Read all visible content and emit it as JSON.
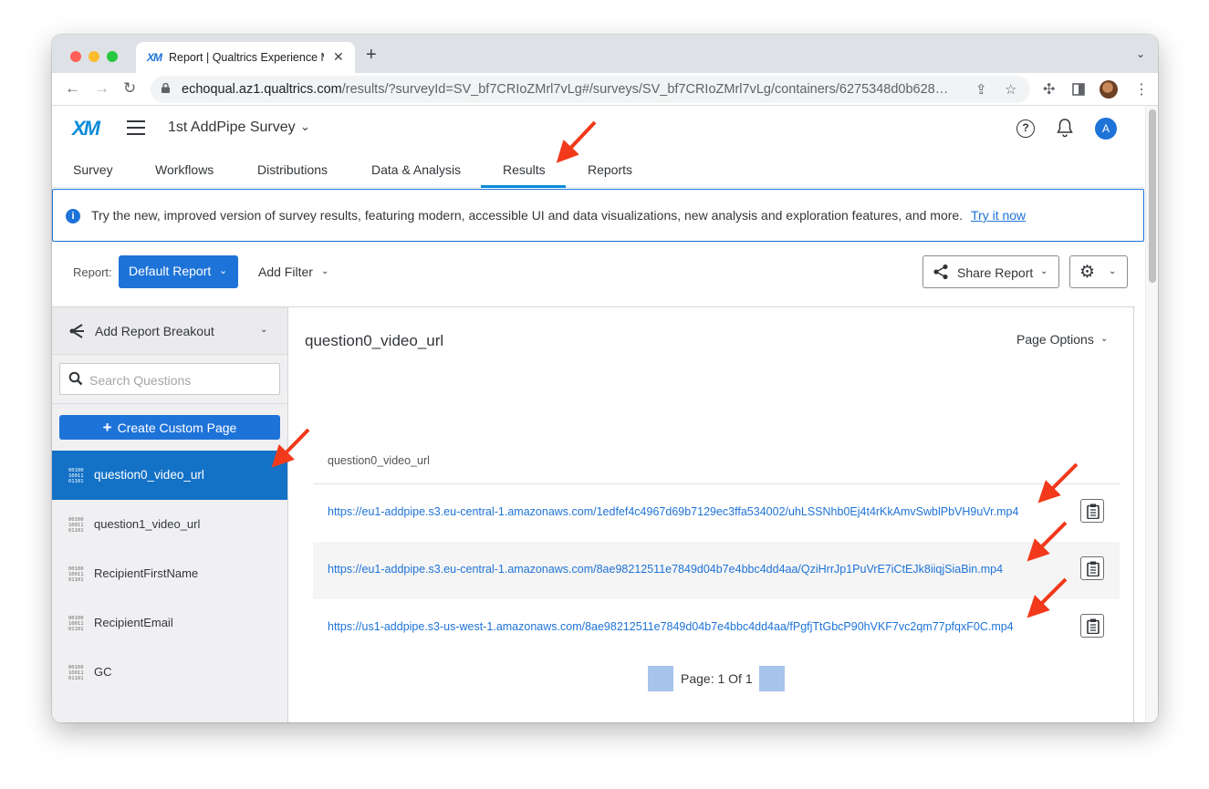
{
  "browser": {
    "tab_title": "Report | Qualtrics Experience Management",
    "tab_favicon": "XM",
    "url_host": "echoqual.az1.qualtrics.com",
    "url_path": "/results/?surveyId=SV_bf7CRIoZMrl7vLg#/surveys/SV_bf7CRIoZMrl7vLg/containers/6275348d0b628…"
  },
  "app": {
    "logo": "XM",
    "survey_name": "1st AddPipe Survey",
    "avatar_initial": "A",
    "nav_tabs": [
      "Survey",
      "Workflows",
      "Distributions",
      "Data & Analysis",
      "Results",
      "Reports"
    ],
    "active_tab": "Results"
  },
  "banner": {
    "text": "Try the new, improved version of survey results, featuring modern, accessible UI and data visualizations, new analysis and exploration features, and more.",
    "link": "Try it now"
  },
  "report_bar": {
    "label": "Report:",
    "selected_report": "Default Report",
    "add_filter": "Add Filter",
    "share_report": "Share Report"
  },
  "sidebar": {
    "breakout": "Add Report Breakout",
    "search_placeholder": "Search Questions",
    "custom_page": "Create Custom Page",
    "binary_icon_text": "00100\n10011\n01101",
    "questions": [
      "question0_video_url",
      "question1_video_url",
      "RecipientFirstName",
      "RecipientEmail",
      "GC"
    ],
    "active_question": "question0_video_url"
  },
  "main": {
    "title": "question0_video_url",
    "page_options": "Page Options",
    "column_header": "question0_video_url",
    "rows": [
      "https://eu1-addpipe.s3.eu-central-1.amazonaws.com/1edfef4c4967d69b7129ec3ffa534002/uhLSSNhb0Ej4t4rKkAmvSwblPbVH9uVr.mp4",
      "https://eu1-addpipe.s3.eu-central-1.amazonaws.com/8ae98212511e7849d04b7e4bbc4dd4aa/QziHrrJp1PuVrE7iCtEJk8iiqjSiaBin.mp4",
      "https://us1-addpipe.s3-us-west-1.amazonaws.com/8ae98212511e7849d04b7e4bbc4dd4aa/fPgfjTtGbcP90hVKF7vc2qm77pfqxF0C.mp4"
    ],
    "pager": "Page: 1 Of 1"
  },
  "colors": {
    "accent": "#1e73d8",
    "active_sidebar": "#1371c6",
    "annotation_arrow": "#f2391b"
  }
}
